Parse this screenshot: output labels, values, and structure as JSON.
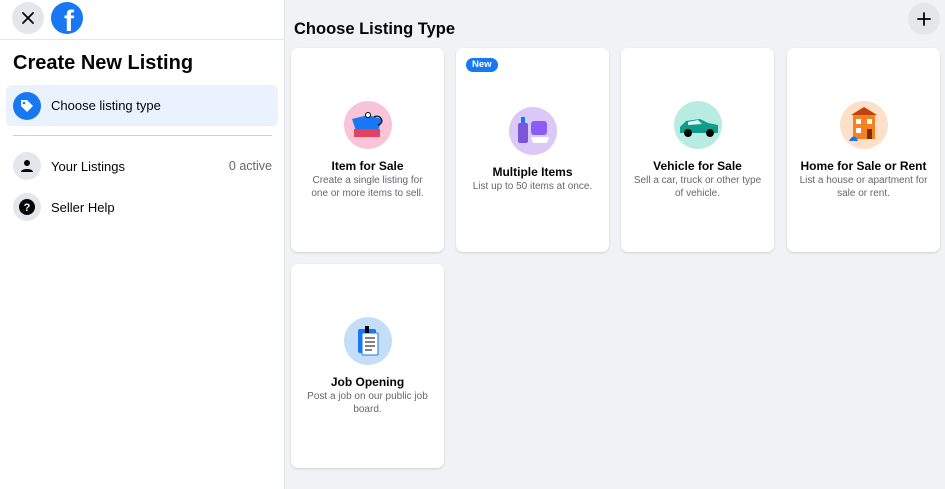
{
  "sidebar": {
    "title": "Create New Listing",
    "active_item": {
      "label": "Choose listing type",
      "icon": "tag-icon"
    },
    "items": [
      {
        "label": "Your Listings",
        "icon": "person-icon",
        "count": "0 active"
      },
      {
        "label": "Seller Help",
        "icon": "question-icon"
      }
    ]
  },
  "main": {
    "title": "Choose Listing Type",
    "cards": [
      {
        "title": "Item for Sale",
        "desc": "Create a single listing for one or more items to sell.",
        "icon": "item-for-sale-icon",
        "icon_bg": "#f9c4d8"
      },
      {
        "badge": "New",
        "title": "Multiple Items",
        "desc": "List up to 50 items at once.",
        "icon": "multiple-items-icon",
        "icon_bg": "#dcc8f7"
      },
      {
        "title": "Vehicle for Sale",
        "desc": "Sell a car, truck or other type of vehicle.",
        "icon": "vehicle-icon",
        "icon_bg": "#b8ebe1"
      },
      {
        "title": "Home for Sale or Rent",
        "desc": "List a house or apartment for sale or rent.",
        "icon": "house-icon",
        "icon_bg": "#fde0c7"
      },
      {
        "title": "Job Opening",
        "desc": "Post a job on our public job board.",
        "icon": "job-icon",
        "icon_bg": "#c5def7"
      }
    ]
  },
  "colors": {
    "accent": "#1877f2",
    "active_bg": "#eaf2fd",
    "page_bg": "#f0f2f5"
  }
}
